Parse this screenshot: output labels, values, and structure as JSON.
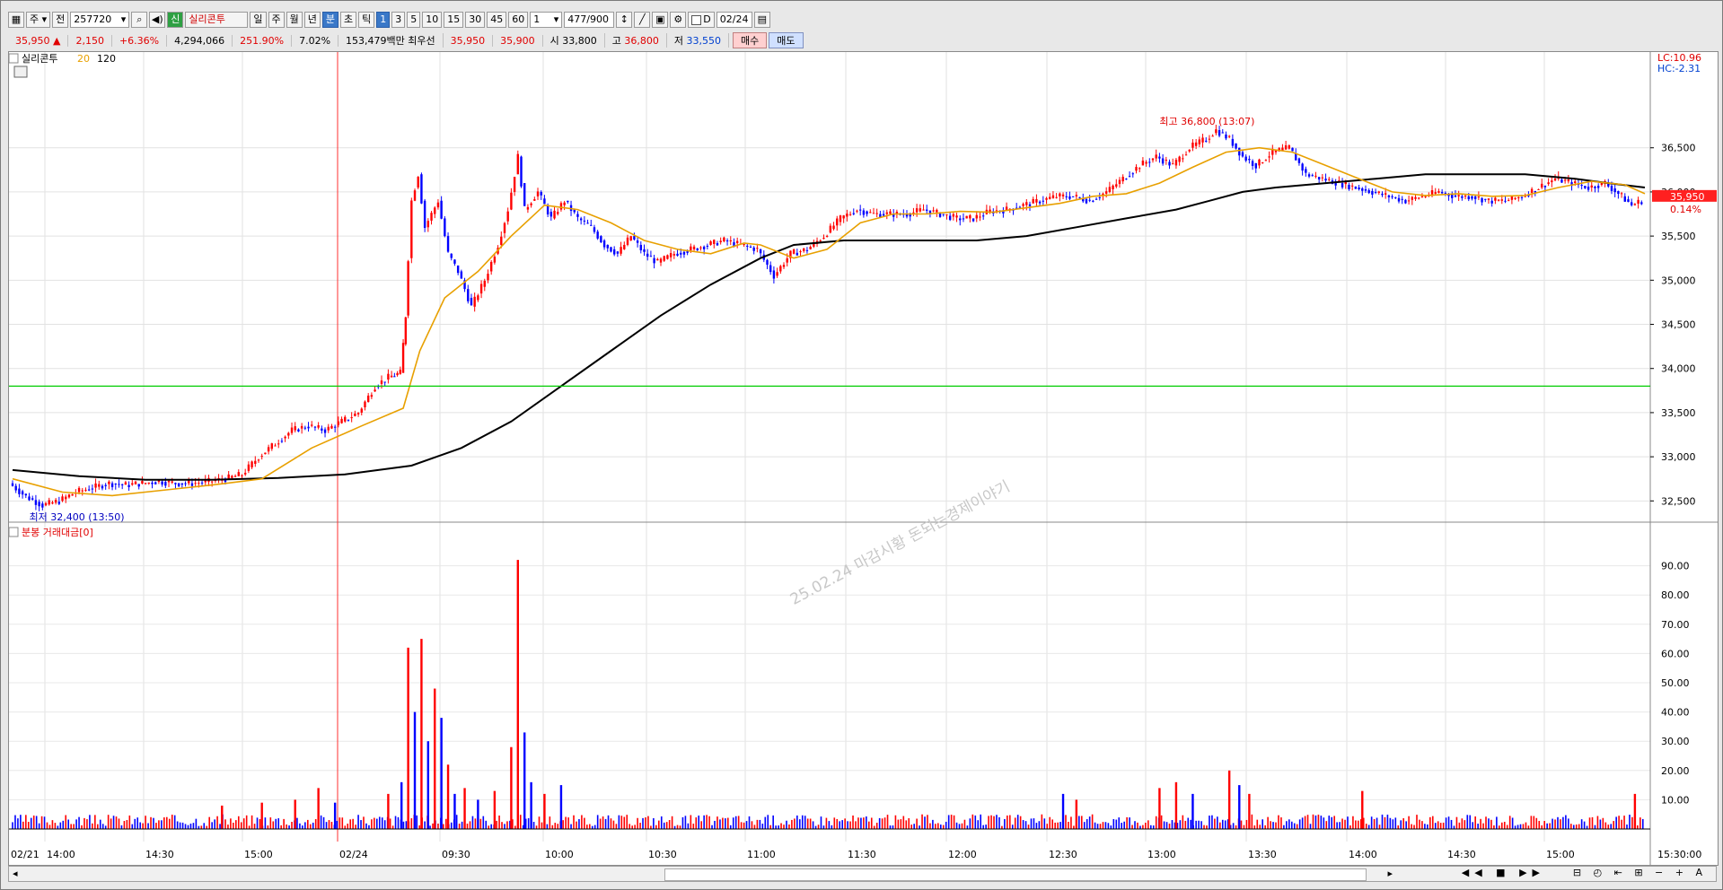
{
  "toolbar": {
    "market": "주",
    "mode": "전",
    "code": "257720",
    "badge": "신",
    "name": "실리콘투",
    "periods": [
      "일",
      "주",
      "월",
      "년",
      "분",
      "초",
      "틱"
    ],
    "selected_period": "분",
    "intervals": [
      "1",
      "3",
      "5",
      "10",
      "15",
      "30",
      "45",
      "60"
    ],
    "selected_interval": "1",
    "multiplier": "1",
    "count": "477",
    "count_max": "/900",
    "date_checkbox": "D",
    "date": "02/24"
  },
  "info": {
    "price": "35,950",
    "change": "2,150",
    "change_pct": "+6.36%",
    "volume": "4,294,066",
    "vol_ratio": "251.90%",
    "turnover": "7.02%",
    "amount": "153,479백만",
    "best_label": "최우선",
    "ask": "35,950",
    "bid": "35,900",
    "open_label": "시",
    "open": "33,800",
    "high_label": "고",
    "high": "36,800",
    "low_label": "저",
    "low": "33,550",
    "buy": "매수",
    "sell": "매도"
  },
  "colors": {
    "up": "#ff0000",
    "down": "#0000ff",
    "ma20": "#e8a000",
    "ma120": "#000000",
    "ref": "#00cc00"
  },
  "chart_data": [
    {
      "type": "candlestick",
      "legend": {
        "name": "실리콘투",
        "ma1": "20",
        "ma2": "120"
      },
      "ylim": [
        32300,
        37300
      ],
      "y_ticks": [
        "36,500",
        "36,000",
        "35,500",
        "35,000",
        "34,500",
        "34,000",
        "33,500",
        "33,000",
        "32,500"
      ],
      "x_ticks": [
        "02/21",
        "14:00",
        "14:30",
        "15:00",
        "02/24",
        "09:30",
        "10:00",
        "10:30",
        "11:00",
        "11:30",
        "12:00",
        "12:30",
        "13:00",
        "13:30",
        "14:00",
        "14:30",
        "15:00",
        "15:30:00"
      ],
      "high_note": "최고 36,800 (13:07)",
      "low_note": "최저 32,400 (13:50)",
      "lc": "LC:10.96",
      "hc": "HC:-2.31",
      "last_price": "35,950",
      "last_pct": "0.14%",
      "ref_line": 33800,
      "watermark": "25.02.24 마감시황 돈되는경제이야기",
      "price_path": [
        [
          0,
          32700
        ],
        [
          10,
          32550
        ],
        [
          20,
          32450
        ],
        [
          30,
          32500
        ],
        [
          40,
          32600
        ],
        [
          50,
          32650
        ],
        [
          60,
          32700
        ],
        [
          70,
          32680
        ],
        [
          80,
          32700
        ],
        [
          90,
          32720
        ],
        [
          100,
          32700
        ],
        [
          110,
          32700
        ],
        [
          120,
          32720
        ],
        [
          130,
          32750
        ],
        [
          140,
          32800
        ],
        [
          150,
          33000
        ],
        [
          160,
          33150
        ],
        [
          170,
          33300
        ],
        [
          180,
          33350
        ],
        [
          190,
          33300
        ],
        [
          200,
          33400
        ],
        [
          210,
          33500
        ],
        [
          220,
          33800
        ],
        [
          228,
          33900
        ],
        [
          235,
          33950
        ],
        [
          238,
          34600
        ],
        [
          242,
          35900
        ],
        [
          246,
          36200
        ],
        [
          250,
          35600
        ],
        [
          258,
          35900
        ],
        [
          264,
          35300
        ],
        [
          270,
          35100
        ],
        [
          278,
          34700
        ],
        [
          286,
          35000
        ],
        [
          294,
          35400
        ],
        [
          300,
          35800
        ],
        [
          306,
          36400
        ],
        [
          310,
          35800
        ],
        [
          318,
          36000
        ],
        [
          326,
          35700
        ],
        [
          334,
          35900
        ],
        [
          342,
          35700
        ],
        [
          350,
          35600
        ],
        [
          358,
          35400
        ],
        [
          366,
          35300
        ],
        [
          374,
          35500
        ],
        [
          382,
          35300
        ],
        [
          390,
          35200
        ],
        [
          400,
          35300
        ],
        [
          410,
          35350
        ],
        [
          420,
          35400
        ],
        [
          430,
          35450
        ],
        [
          440,
          35400
        ],
        [
          450,
          35350
        ],
        [
          460,
          35050
        ],
        [
          470,
          35300
        ],
        [
          480,
          35350
        ],
        [
          490,
          35500
        ],
        [
          500,
          35700
        ],
        [
          510,
          35800
        ],
        [
          520,
          35750
        ],
        [
          530,
          35750
        ],
        [
          540,
          35750
        ],
        [
          550,
          35800
        ],
        [
          560,
          35750
        ],
        [
          570,
          35700
        ],
        [
          580,
          35700
        ],
        [
          590,
          35780
        ],
        [
          600,
          35800
        ],
        [
          610,
          35850
        ],
        [
          620,
          35900
        ],
        [
          630,
          35950
        ],
        [
          640,
          35950
        ],
        [
          650,
          35900
        ],
        [
          660,
          36000
        ],
        [
          670,
          36150
        ],
        [
          680,
          36300
        ],
        [
          690,
          36400
        ],
        [
          700,
          36300
        ],
        [
          710,
          36500
        ],
        [
          720,
          36600
        ],
        [
          726,
          36700
        ],
        [
          734,
          36600
        ],
        [
          742,
          36400
        ],
        [
          750,
          36300
        ],
        [
          760,
          36450
        ],
        [
          770,
          36500
        ],
        [
          780,
          36200
        ],
        [
          790,
          36150
        ],
        [
          800,
          36100
        ],
        [
          810,
          36050
        ],
        [
          820,
          36000
        ],
        [
          830,
          35950
        ],
        [
          840,
          35900
        ],
        [
          850,
          35950
        ],
        [
          860,
          36000
        ],
        [
          870,
          35950
        ],
        [
          880,
          35950
        ],
        [
          890,
          35900
        ],
        [
          900,
          35900
        ],
        [
          910,
          35950
        ],
        [
          920,
          36050
        ],
        [
          930,
          36150
        ],
        [
          940,
          36100
        ],
        [
          950,
          36050
        ],
        [
          960,
          36100
        ],
        [
          970,
          35950
        ],
        [
          976,
          35850
        ],
        [
          982,
          35900
        ]
      ],
      "ma20_path": [
        [
          0,
          32750
        ],
        [
          30,
          32600
        ],
        [
          60,
          32560
        ],
        [
          90,
          32620
        ],
        [
          120,
          32680
        ],
        [
          150,
          32750
        ],
        [
          180,
          33100
        ],
        [
          210,
          33350
        ],
        [
          235,
          33550
        ],
        [
          245,
          34200
        ],
        [
          260,
          34800
        ],
        [
          280,
          35100
        ],
        [
          300,
          35500
        ],
        [
          320,
          35850
        ],
        [
          340,
          35800
        ],
        [
          360,
          35650
        ],
        [
          380,
          35450
        ],
        [
          400,
          35350
        ],
        [
          420,
          35300
        ],
        [
          440,
          35420
        ],
        [
          450,
          35400
        ],
        [
          470,
          35250
        ],
        [
          490,
          35350
        ],
        [
          510,
          35650
        ],
        [
          530,
          35750
        ],
        [
          550,
          35750
        ],
        [
          570,
          35780
        ],
        [
          590,
          35770
        ],
        [
          610,
          35820
        ],
        [
          630,
          35870
        ],
        [
          650,
          35950
        ],
        [
          670,
          35980
        ],
        [
          690,
          36100
        ],
        [
          710,
          36280
        ],
        [
          730,
          36450
        ],
        [
          750,
          36500
        ],
        [
          770,
          36450
        ],
        [
          790,
          36300
        ],
        [
          810,
          36150
        ],
        [
          830,
          36000
        ],
        [
          850,
          35960
        ],
        [
          870,
          35980
        ],
        [
          890,
          35950
        ],
        [
          910,
          35960
        ],
        [
          930,
          36050
        ],
        [
          950,
          36120
        ],
        [
          970,
          36080
        ],
        [
          982,
          35980
        ]
      ],
      "ma120_path": [
        [
          0,
          32850
        ],
        [
          40,
          32780
        ],
        [
          80,
          32740
        ],
        [
          120,
          32740
        ],
        [
          160,
          32760
        ],
        [
          200,
          32800
        ],
        [
          240,
          32900
        ],
        [
          270,
          33100
        ],
        [
          300,
          33400
        ],
        [
          330,
          33800
        ],
        [
          360,
          34200
        ],
        [
          390,
          34600
        ],
        [
          420,
          34950
        ],
        [
          450,
          35250
        ],
        [
          470,
          35400
        ],
        [
          500,
          35450
        ],
        [
          540,
          35450
        ],
        [
          580,
          35450
        ],
        [
          610,
          35500
        ],
        [
          640,
          35600
        ],
        [
          670,
          35700
        ],
        [
          700,
          35800
        ],
        [
          720,
          35900
        ],
        [
          740,
          36000
        ],
        [
          760,
          36050
        ],
        [
          790,
          36100
        ],
        [
          820,
          36150
        ],
        [
          850,
          36200
        ],
        [
          880,
          36200
        ],
        [
          910,
          36200
        ],
        [
          940,
          36150
        ],
        [
          960,
          36100
        ],
        [
          982,
          36050
        ]
      ]
    },
    {
      "type": "bar",
      "title": "분봉 거래대금[0]",
      "ylim": [
        0,
        100
      ],
      "y_ticks": [
        "90.00",
        "80.00",
        "70.00",
        "60.00",
        "50.00",
        "40.00",
        "30.00",
        "20.00",
        "10.00"
      ],
      "spikes": [
        [
          238,
          62,
          "up"
        ],
        [
          242,
          40,
          "down"
        ],
        [
          246,
          65,
          "up"
        ],
        [
          250,
          30,
          "down"
        ],
        [
          254,
          48,
          "up"
        ],
        [
          258,
          38,
          "down"
        ],
        [
          262,
          22,
          "up"
        ],
        [
          266,
          12,
          "down"
        ],
        [
          272,
          14,
          "up"
        ],
        [
          280,
          10,
          "down"
        ],
        [
          290,
          13,
          "up"
        ],
        [
          300,
          28,
          "up"
        ],
        [
          304,
          92,
          "up"
        ],
        [
          308,
          33,
          "down"
        ],
        [
          312,
          16,
          "down"
        ],
        [
          320,
          12,
          "up"
        ],
        [
          330,
          15,
          "down"
        ],
        [
          126,
          8,
          "up"
        ],
        [
          150,
          9,
          "up"
        ],
        [
          170,
          10,
          "up"
        ],
        [
          184,
          14,
          "up"
        ],
        [
          194,
          9,
          "down"
        ],
        [
          226,
          12,
          "up"
        ],
        [
          234,
          16,
          "down"
        ],
        [
          632,
          12,
          "down"
        ],
        [
          640,
          10,
          "up"
        ],
        [
          690,
          14,
          "up"
        ],
        [
          700,
          16,
          "up"
        ],
        [
          710,
          12,
          "down"
        ],
        [
          732,
          20,
          "up"
        ],
        [
          738,
          15,
          "down"
        ],
        [
          744,
          12,
          "up"
        ],
        [
          812,
          13,
          "up"
        ],
        [
          976,
          12,
          "up"
        ]
      ]
    }
  ]
}
